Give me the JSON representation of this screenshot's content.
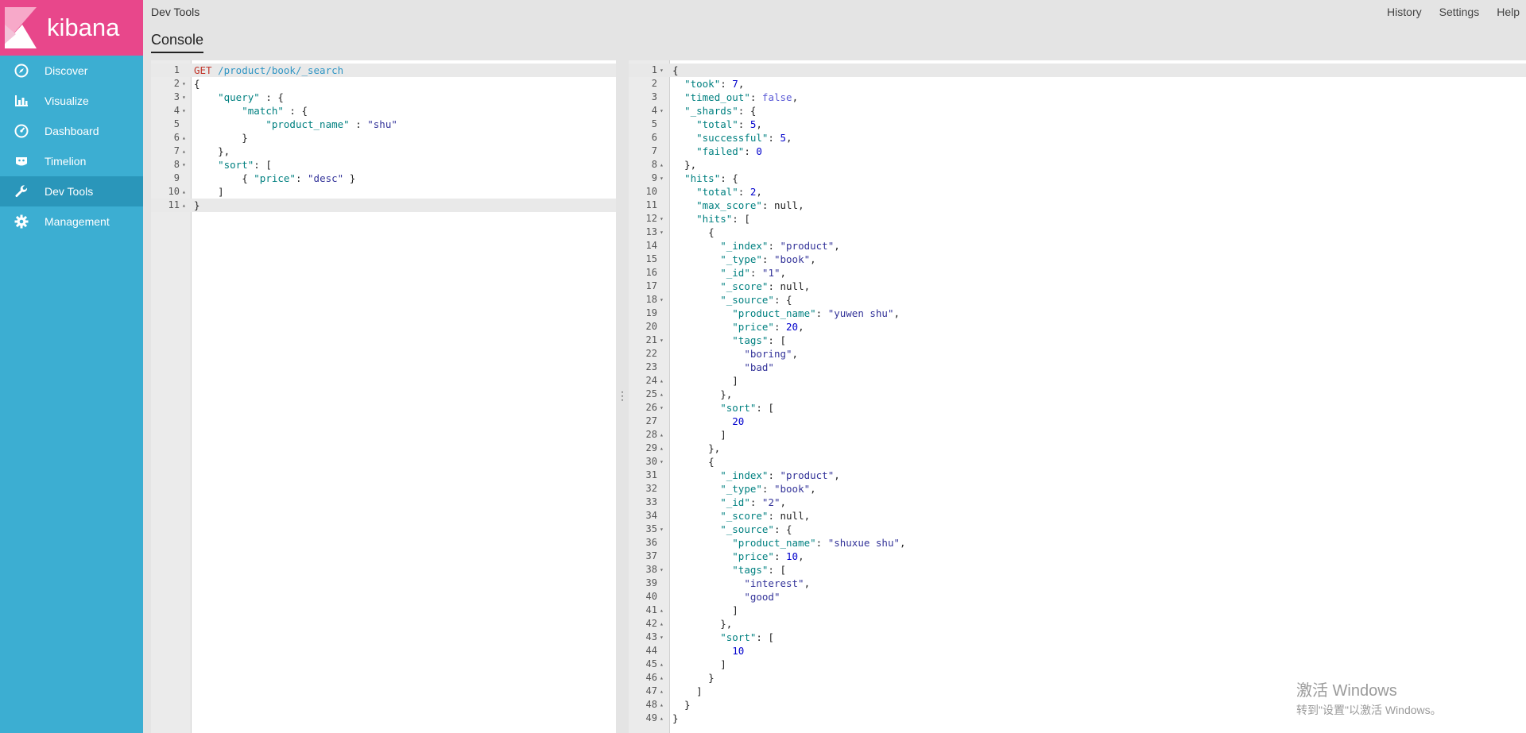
{
  "brand": {
    "name": "kibana",
    "logo_color": "#e8478b"
  },
  "sidebar": {
    "bg_color": "#3caed2",
    "active_color": "#2a96ba",
    "items": [
      {
        "label": "Discover",
        "icon": "compass-icon"
      },
      {
        "label": "Visualize",
        "icon": "bar-chart-icon"
      },
      {
        "label": "Dashboard",
        "icon": "dashboard-icon"
      },
      {
        "label": "Timelion",
        "icon": "timelion-icon"
      },
      {
        "label": "Dev Tools",
        "icon": "wrench-icon",
        "active": true
      },
      {
        "label": "Management",
        "icon": "gear-icon"
      }
    ]
  },
  "header": {
    "title": "Dev Tools",
    "links": [
      "History",
      "Settings",
      "Help"
    ],
    "tab": "Console"
  },
  "request": {
    "lines": [
      "GET /product/book/_search",
      "{",
      "    \"query\" : {",
      "        \"match\" : {",
      "            \"product_name\" : \"shu\"",
      "        }",
      "    },",
      "    \"sort\": [",
      "        { \"price\": \"desc\" }",
      "    ]",
      "}"
    ]
  },
  "response": {
    "lines": [
      "{",
      "  \"took\": 7,",
      "  \"timed_out\": false,",
      "  \"_shards\": {",
      "    \"total\": 5,",
      "    \"successful\": 5,",
      "    \"failed\": 0",
      "  },",
      "  \"hits\": {",
      "    \"total\": 2,",
      "    \"max_score\": null,",
      "    \"hits\": [",
      "      {",
      "        \"_index\": \"product\",",
      "        \"_type\": \"book\",",
      "        \"_id\": \"1\",",
      "        \"_score\": null,",
      "        \"_source\": {",
      "          \"product_name\": \"yuwen shu\",",
      "          \"price\": 20,",
      "          \"tags\": [",
      "            \"boring\",",
      "            \"bad\"",
      "          ]",
      "        },",
      "        \"sort\": [",
      "          20",
      "        ]",
      "      },",
      "      {",
      "        \"_index\": \"product\",",
      "        \"_type\": \"book\",",
      "        \"_id\": \"2\",",
      "        \"_score\": null,",
      "        \"_source\": {",
      "          \"product_name\": \"shuxue shu\",",
      "          \"price\": 10,",
      "          \"tags\": [",
      "            \"interest\",",
      "            \"good\"",
      "          ]",
      "        },",
      "        \"sort\": [",
      "          10",
      "        ]",
      "      }",
      "    ]",
      "  }",
      "}"
    ]
  },
  "watermark": {
    "title": "激活 Windows",
    "subtitle": "转到\"设置\"以激活 Windows。"
  }
}
